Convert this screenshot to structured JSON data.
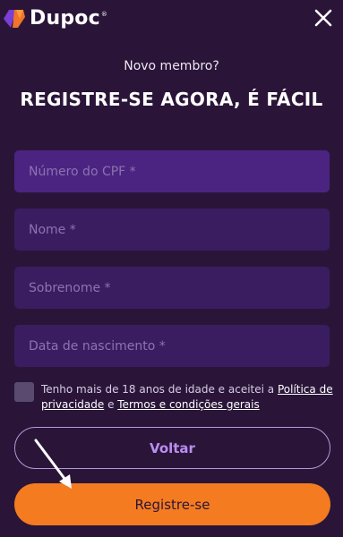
{
  "header": {
    "brand": "Dupoc",
    "brand_mark": "®"
  },
  "intro": {
    "subtitle": "Novo membro?",
    "title": "REGISTRE-SE AGORA, É FÁCIL"
  },
  "form": {
    "cpf_placeholder": "Número do CPF *",
    "name_placeholder": "Nome *",
    "surname_placeholder": "Sobrenome *",
    "birthdate_placeholder": "Data de nascimento *"
  },
  "consent": {
    "text_before": "Tenho mais de 18 anos de idade e aceitei a ",
    "privacy_link": "Política de privacidade",
    "text_and": " e ",
    "terms_link": "Termos e condições gerais",
    "checked": false
  },
  "buttons": {
    "back_label": "Voltar",
    "register_label": "Registre-se"
  },
  "colors": {
    "background": "#2a1539",
    "field_active": "#4b2482",
    "field": "#3a1d60",
    "accent_orange": "#f47b20",
    "accent_purple": "#b98ef0"
  },
  "icons": {
    "logo": "dupoc-logo-icon",
    "close": "close-icon",
    "arrow": "pointer-arrow-icon"
  }
}
